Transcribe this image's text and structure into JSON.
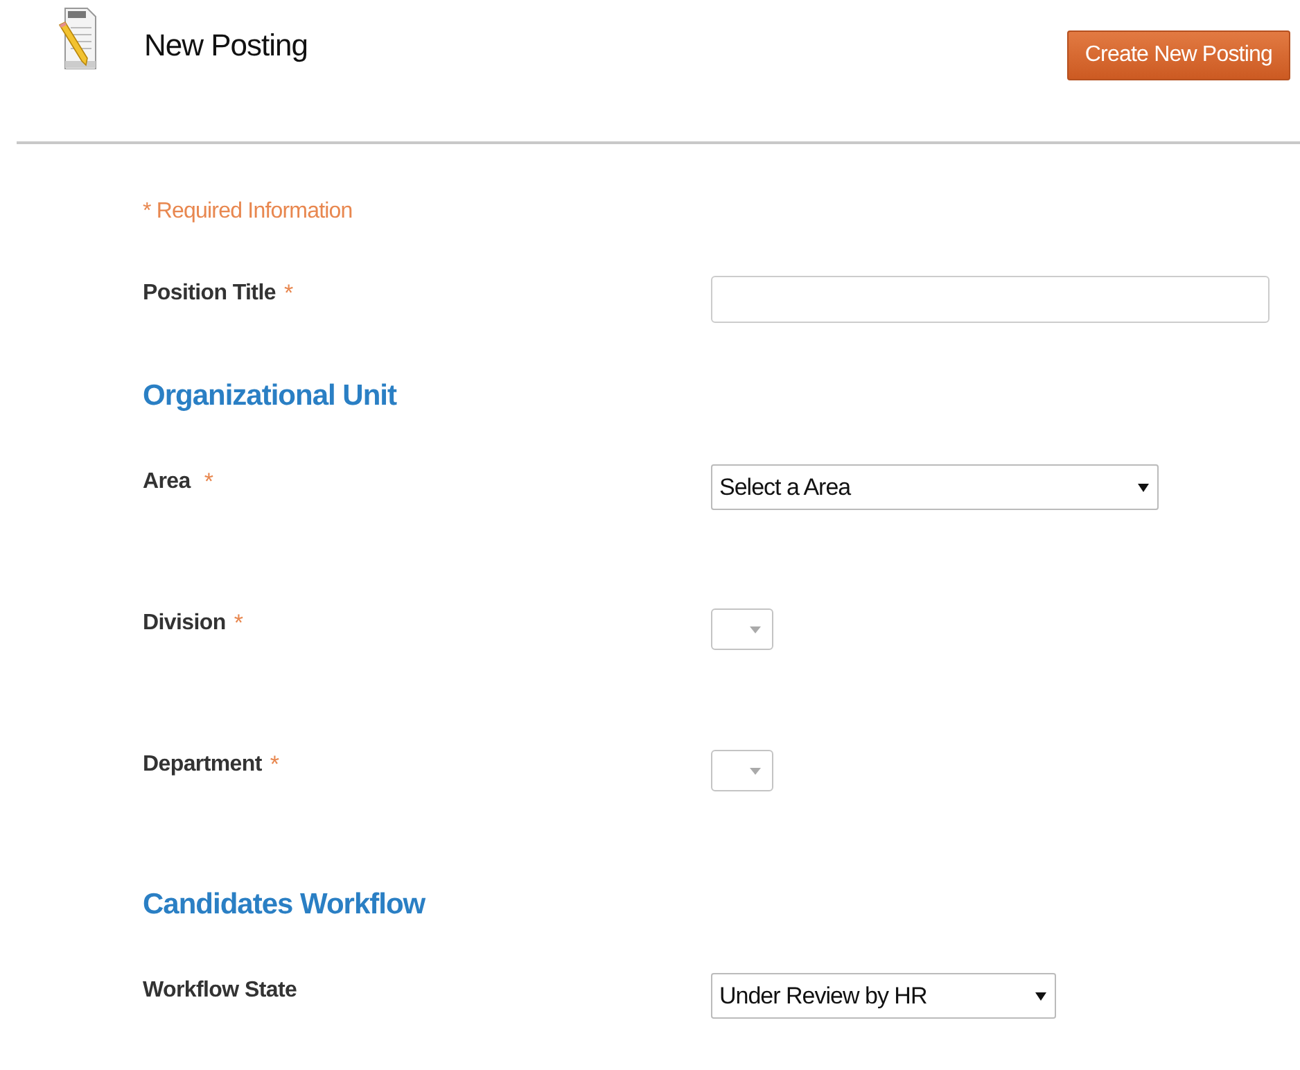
{
  "header": {
    "title": "New Posting",
    "button": "Create New Posting"
  },
  "required_note": "* Required Information",
  "rows": [
    {
      "kind": "text",
      "label": "Position Title",
      "marker": "*",
      "value": ""
    },
    {
      "kind": "heading",
      "label": "Organizational Unit"
    },
    {
      "kind": "select",
      "label": "Area",
      "marker": "*",
      "value": "Select a Area"
    },
    {
      "kind": "empty-select",
      "label": "Division",
      "marker": "*"
    },
    {
      "kind": "empty-select",
      "label": "Department",
      "marker": "*"
    },
    {
      "kind": "heading",
      "label": "Candidates Workflow"
    },
    {
      "kind": "select",
      "label": "Workflow State",
      "value": "Under Review by HR"
    }
  ]
}
